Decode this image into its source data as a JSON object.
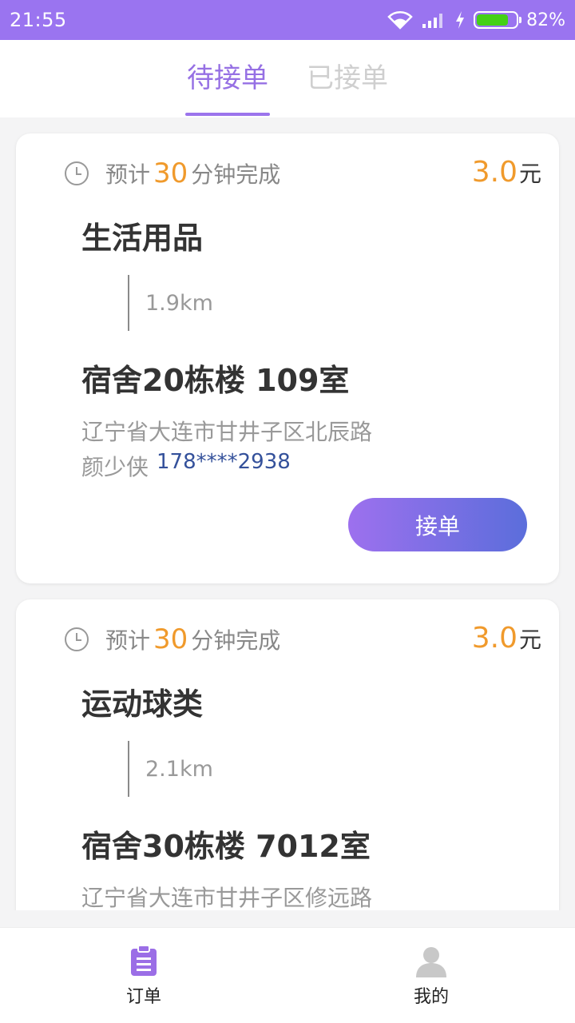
{
  "status": {
    "time": "21:55",
    "battery_pct": "82%",
    "battery_level": 0.82,
    "wifi_icon": "wifi-icon",
    "signal_icon": "signal-icon",
    "charging_icon": "charging-icon"
  },
  "tabs": [
    {
      "label": "待接单",
      "active": true
    },
    {
      "label": "已接单",
      "active": false
    }
  ],
  "orders": [
    {
      "eta_prefix": "预计",
      "eta_minutes": "30",
      "eta_suffix": "分钟完成",
      "price": "3.0",
      "price_unit": "元",
      "title": "生活用品",
      "distance": "1.9km",
      "destination": "宿舍20栋楼 109室",
      "address": "辽宁省大连市甘井子区北辰路",
      "name": "颜少侠",
      "phone": "178****2938",
      "accept_label": "接单"
    },
    {
      "eta_prefix": "预计",
      "eta_minutes": "30",
      "eta_suffix": "分钟完成",
      "price": "3.0",
      "price_unit": "元",
      "title": "运动球类",
      "distance": "2.1km",
      "destination": "宿舍30栋楼 7012室",
      "address": "辽宁省大连市甘井子区修远路"
    }
  ],
  "nav": [
    {
      "label": "订单",
      "icon": "clipboard-icon",
      "color": "#9b6ee6"
    },
    {
      "label": "我的",
      "icon": "person-icon",
      "color": "#c8c8c8"
    }
  ],
  "colors": {
    "accent": "#9a74f0",
    "price": "#f09a2c",
    "phone": "#34519b"
  }
}
